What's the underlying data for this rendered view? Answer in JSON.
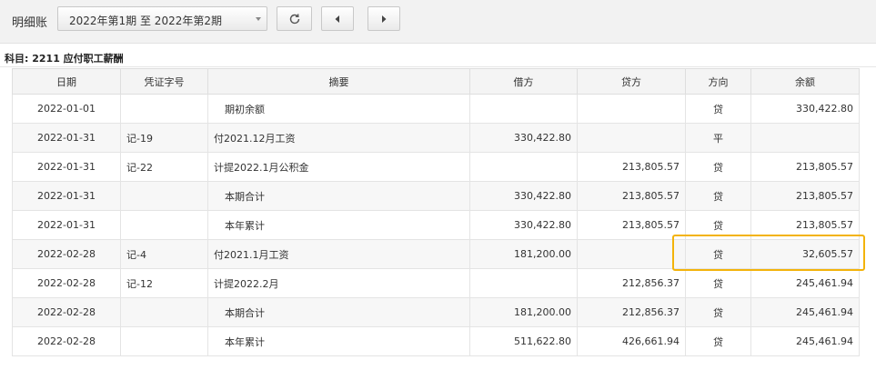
{
  "toolbar": {
    "title": "明细账",
    "period_range": "2022年第1期 至 2022年第2期"
  },
  "subject_line": "科目: 2211 应付职工薪酬",
  "table": {
    "headers": [
      "日期",
      "凭证字号",
      "摘要",
      "借方",
      "贷方",
      "方向",
      "余额"
    ],
    "rows": [
      [
        "2022-01-01",
        "",
        "期初余额",
        "",
        "",
        "贷",
        "330,422.80"
      ],
      [
        "2022-01-31",
        "记-19",
        "付2021.12月工资",
        "330,422.80",
        "",
        "平",
        ""
      ],
      [
        "2022-01-31",
        "记-22",
        "计提2022.1月公积金",
        "",
        "213,805.57",
        "贷",
        "213,805.57"
      ],
      [
        "2022-01-31",
        "",
        "本期合计",
        "330,422.80",
        "213,805.57",
        "贷",
        "213,805.57"
      ],
      [
        "2022-01-31",
        "",
        "本年累计",
        "330,422.80",
        "213,805.57",
        "贷",
        "213,805.57"
      ],
      [
        "2022-02-28",
        "记-4",
        "付2021.1月工资",
        "181,200.00",
        "",
        "贷",
        "32,605.57"
      ],
      [
        "2022-02-28",
        "记-12",
        "计提2022.2月",
        "",
        "212,856.37",
        "贷",
        "245,461.94"
      ],
      [
        "2022-02-28",
        "",
        "本期合计",
        "181,200.00",
        "212,856.37",
        "贷",
        "245,461.94"
      ],
      [
        "2022-02-28",
        "",
        "本年累计",
        "511,622.80",
        "426,661.94",
        "贷",
        "245,461.94"
      ]
    ]
  },
  "colors": {
    "highlight": "#f3b30a",
    "header_bg": "#f4f4f4"
  },
  "icons": [
    "refresh-icon",
    "prev-arrow-icon",
    "next-arrow-icon",
    "chevron-down-icon"
  ]
}
